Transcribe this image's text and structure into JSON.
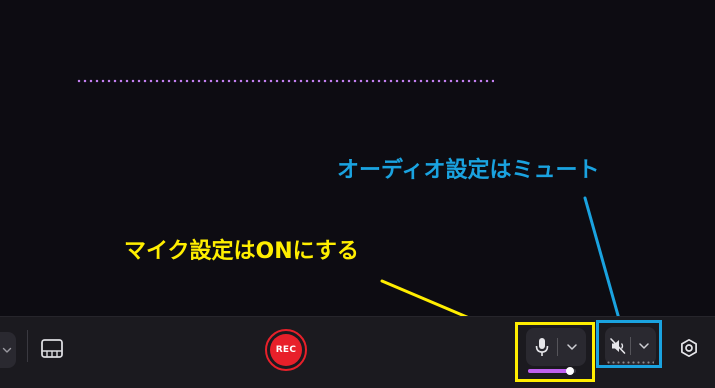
{
  "colors": {
    "background": "#0d0c12",
    "toolbar": "#1b1a1f",
    "dotted_line": "#c37ff0",
    "rec": "#e8202a",
    "annotation_yellow": "#ffee00",
    "annotation_blue": "#1aa3e0",
    "level": "#c060f0"
  },
  "annotations": {
    "audio": "オーディオ設定はミュート",
    "mic": "マイク設定はONにする"
  },
  "toolbar": {
    "rec_label": "REC",
    "mic_level": 0.88
  },
  "icons": {
    "left_control": "chevron-down-icon",
    "layout": "layout-icon",
    "mic": "microphone-icon",
    "mic_menu": "chevron-down-icon",
    "audio": "speaker-muted-icon",
    "audio_menu": "chevron-down-icon",
    "settings": "settings-icon"
  }
}
